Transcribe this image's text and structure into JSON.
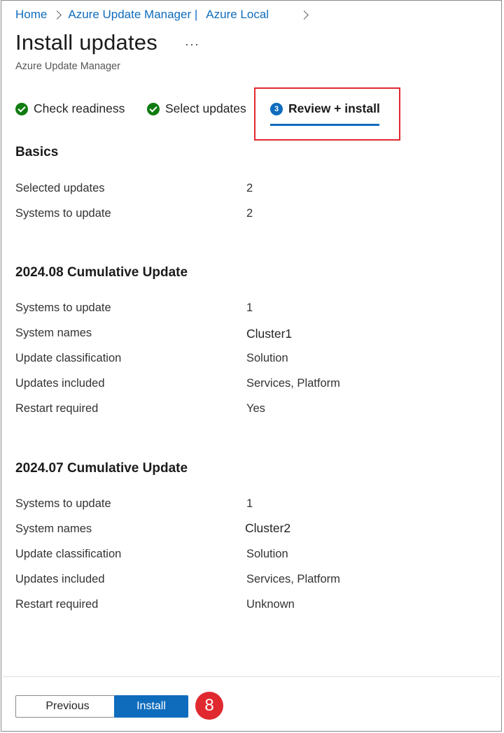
{
  "breadcrumb": {
    "home": "Home",
    "manager": "Azure Update Manager |",
    "local": "Azure Local"
  },
  "header": {
    "title": "Install updates",
    "more": "···",
    "subtitle": "Azure Update Manager"
  },
  "steps": [
    {
      "label": "Check readiness",
      "state": "complete",
      "icon": "check-circle-icon"
    },
    {
      "label": "Select updates",
      "state": "complete",
      "icon": "check-circle-icon"
    },
    {
      "label": "Review + install",
      "state": "active",
      "number": "3"
    }
  ],
  "basics": {
    "title": "Basics",
    "rows": [
      {
        "label": "Selected updates",
        "value": "2"
      },
      {
        "label": "Systems to update",
        "value": "2"
      }
    ]
  },
  "updates": [
    {
      "title": "2024.08 Cumulative Update",
      "rows": [
        {
          "label": "Systems to update",
          "value": "1"
        },
        {
          "label": "System names",
          "value": "Cluster1"
        },
        {
          "label": "Update classification",
          "value": "Solution"
        },
        {
          "label": "Updates included",
          "value": "Services, Platform"
        },
        {
          "label": "Restart required",
          "value": "Yes"
        }
      ]
    },
    {
      "title": "2024.07 Cumulative Update",
      "rows": [
        {
          "label": "Systems to update",
          "value": "1"
        },
        {
          "label": "System names",
          "value": "Cluster2"
        },
        {
          "label": "Update classification",
          "value": "Solution"
        },
        {
          "label": "Updates included",
          "value": "Services, Platform"
        },
        {
          "label": "Restart required",
          "value": "Unknown"
        }
      ]
    }
  ],
  "footer": {
    "previous": "Previous",
    "install": "Install",
    "callout": "8"
  },
  "colors": {
    "accent": "#0f6cbd",
    "success": "#107c10",
    "callout": "#e0292f"
  }
}
